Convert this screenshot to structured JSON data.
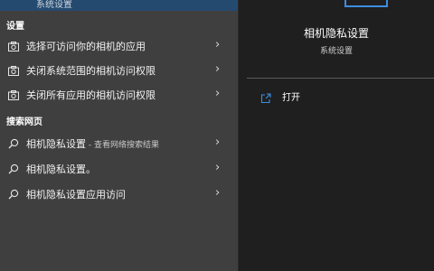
{
  "top_item": {
    "subtitle": "系统设置"
  },
  "sections": {
    "settings_header": "设置",
    "web_header": "搜索网页"
  },
  "settings_items": [
    {
      "label": "选择可访问你的相机的应用",
      "icon": "camera-icon"
    },
    {
      "label": "关闭系统范围的相机访问权限",
      "icon": "camera-icon"
    },
    {
      "label": "关闭所有应用的相机访问权限",
      "icon": "camera-icon"
    }
  ],
  "web_items": [
    {
      "label": "相机隐私设置",
      "suffix": " - 查看网络搜索结果",
      "icon": "search-icon"
    },
    {
      "label": "相机隐私设置。",
      "suffix": "",
      "icon": "search-icon"
    },
    {
      "label": "相机隐私设置应用访问",
      "suffix": "",
      "icon": "search-icon"
    }
  ],
  "preview": {
    "title": "相机隐私设置",
    "subtitle": "系统设置",
    "actions": [
      {
        "label": "打开",
        "icon": "open-icon"
      }
    ]
  },
  "colors": {
    "left_bg": "#3f3f3f",
    "right_bg": "#1f1f1f",
    "selected": "#244a70",
    "accent": "#3d8ee0"
  }
}
